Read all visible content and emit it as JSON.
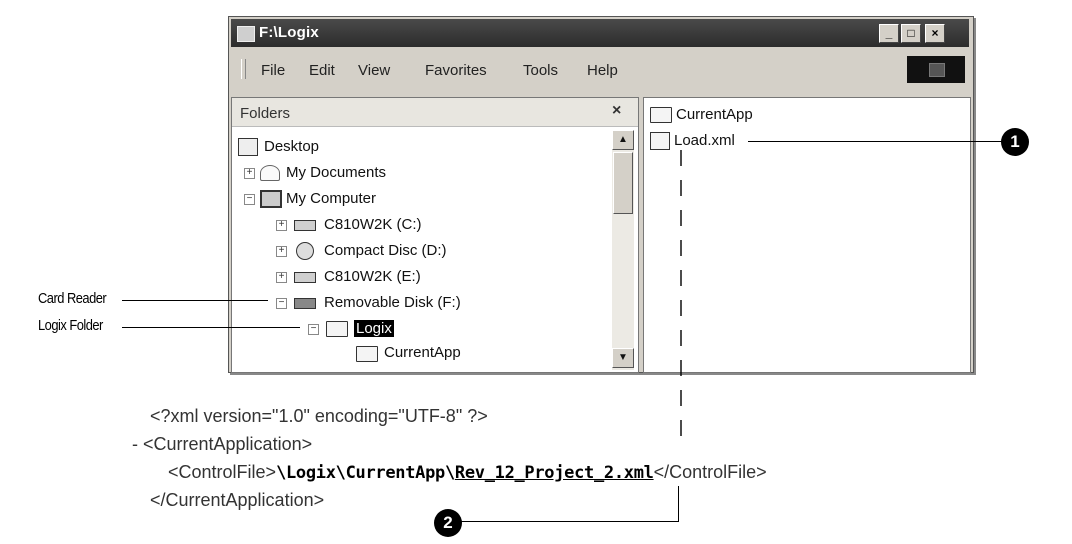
{
  "window": {
    "title": "F:\\Logix",
    "buttons": {
      "minimize": "_",
      "maximize": "□",
      "close": "×"
    }
  },
  "menu": [
    "File",
    "Edit",
    "View",
    "Favorites",
    "Tools",
    "Help"
  ],
  "folders_pane": {
    "title": "Folders",
    "close": "×",
    "tree": [
      {
        "label": "Desktop",
        "icon": "desktop-icon",
        "expander": ""
      },
      {
        "label": "My Documents",
        "icon": "my-documents-icon",
        "expander": "+"
      },
      {
        "label": "My Computer",
        "icon": "computer-icon",
        "expander": "−"
      },
      {
        "label": "C810W2K (C:)",
        "icon": "drive-icon",
        "expander": "+"
      },
      {
        "label": "Compact Disc (D:)",
        "icon": "cd-icon",
        "expander": "+"
      },
      {
        "label": "C810W2K (E:)",
        "icon": "drive-icon",
        "expander": "+"
      },
      {
        "label": "Removable Disk (F:)",
        "icon": "removable-disk-icon",
        "expander": "−"
      },
      {
        "label": "Logix",
        "icon": "folder-open-icon",
        "expander": "−"
      },
      {
        "label": "CurrentApp",
        "icon": "folder-icon",
        "expander": ""
      }
    ]
  },
  "file_pane": {
    "items": [
      {
        "label": "CurrentApp",
        "icon": "folder-icon"
      },
      {
        "label": "Load.xml",
        "icon": "xml-file-icon"
      }
    ]
  },
  "callouts": {
    "card_reader": "Card Reader",
    "logix_folder": "Logix Folder",
    "badge1": "1",
    "badge2": "2"
  },
  "xml": {
    "line1": "<?xml version=\"1.0\" encoding=\"UTF-8\" ?>",
    "line2": "- <CurrentApplication>",
    "line3_open": "<ControlFile>",
    "line3_path": "\\Logix\\CurrentApp\\",
    "line3_file": "Rev_12_Project_2.xml",
    "line3_close": "</ControlFile>",
    "line4": "</CurrentApplication>"
  }
}
